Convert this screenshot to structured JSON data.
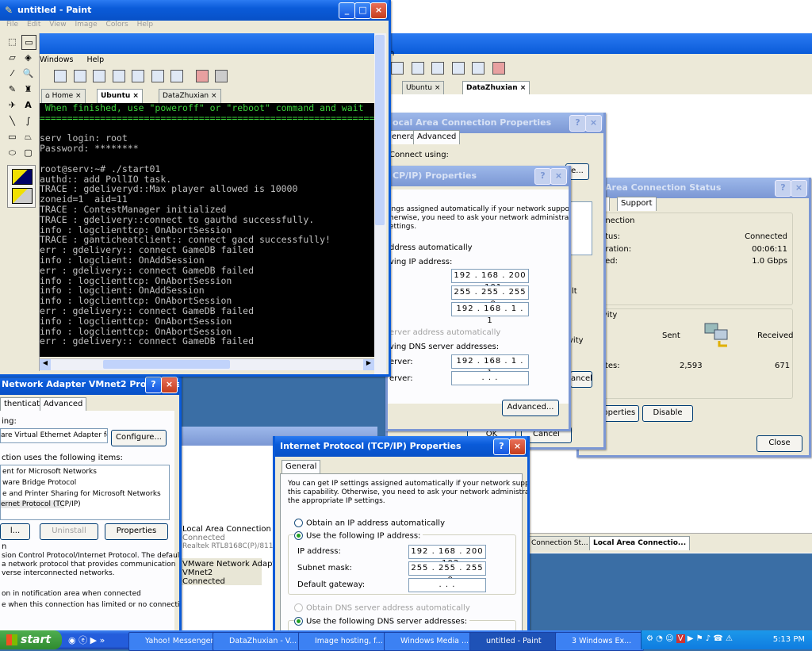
{
  "paint": {
    "title": "untitled - Paint",
    "menu": [
      "File",
      "Edit",
      "View",
      "Image",
      "Colors",
      "Help"
    ]
  },
  "vmware_back": {
    "tabs": [
      "Ubuntu",
      "DataZhuxian"
    ],
    "menu_letter": "n"
  },
  "vmware_front": {
    "menu": [
      "Windows",
      "Help"
    ],
    "tabs": [
      "Home",
      "Ubuntu",
      "DataZhuxian"
    ],
    "terminal_lines": [
      " When finished, use \"poweroff\" or \"reboot\" command and wait",
      "=============================================================",
      "",
      "serv login: root",
      "Password: ********",
      "",
      "root@serv:~# ./start01",
      "authd:: add PollIO task.",
      "TRACE : gdeliveryd::Max player allowed is 10000",
      "zoneid=1  aid=11",
      "TRACE : ContestManager initialized",
      "TRACE : gdelivery::connect to gauthd successfully.",
      "info : logclienttcp: OnAbortSession",
      "TRACE : ganticheatclient:: connect gacd successfully!",
      "err : gdelivery:: connect GameDB failed",
      "info : logclient: OnAddSession",
      "err : gdelivery:: connect GameDB failed",
      "info : logclienttcp: OnAbortSession",
      "info : logclient: OnAddSession",
      "info : logclienttcp: OnAbortSession",
      "err : gdelivery:: connect GameDB failed",
      "info : logclienttcp: OnAbortSession",
      "info : logclienttcp: OnAbortSession",
      "err : gdelivery:: connect GameDB failed"
    ]
  },
  "lac_props": {
    "title": "ocal Area Connection Properties",
    "tabs": [
      "eneral",
      "Advanced"
    ],
    "connect_using": "Connect using:",
    "configure": "e...",
    "ok": "OK",
    "cancel": "Cancel",
    "cancel_frag": "ancel",
    "frag_lt": "lt",
    "frag_vity": "vity"
  },
  "tcp_back": {
    "title": "CP/IP) Properties",
    "desc": "ings assigned automatically if your network supports\nherwise, you need to ask your network administrator for\nettings.",
    "obtain_auto": "ddress automatically",
    "use_following": "ving IP address:",
    "ip": "192 . 168 . 200 . 101",
    "mask": "255 . 255 . 255 . 0",
    "gateway": "192 . 168 . 1 . 1",
    "dns_auto": "erver address automatically",
    "dns_following": "ving DNS server addresses:",
    "pref_dns_label": "erver:",
    "pref_dns": "192 . 168 . 1 . 1",
    "alt_dns_label": "erver:",
    "alt_dns": ".       .       .",
    "advanced": "Advanced...",
    "ok": "OK",
    "cancel": "Cancel"
  },
  "status": {
    "title": "al Area Connection Status",
    "tabs": [
      "al",
      "Support"
    ],
    "connection": "nnection",
    "status_label": "atus:",
    "status_value": "Connected",
    "duration_label": "uration:",
    "duration_value": "00:06:11",
    "speed_label": "eed:",
    "speed_value": "1.0 Gbps",
    "activity": "ivity",
    "sent": "Sent",
    "received": "Received",
    "bytes_label": "ytes:",
    "sent_bytes": "2,593",
    "received_bytes": "671",
    "properties": "Properties",
    "disable": "Disable",
    "close": "Close"
  },
  "vmnet": {
    "title": "Network Adapter VMnet2 Properties",
    "tabs": [
      "thentication",
      "Advanced"
    ],
    "connect_using": "ing:",
    "adapter": "are Virtual Ethernet Adapter for V",
    "configure": "Configure...",
    "items_label": "ction uses the following items:",
    "items": [
      "ent for Microsoft Networks",
      "ware Bridge Protocol",
      "e and Printer Sharing for Microsoft Networks",
      "ernet Protocol (TCP/IP)"
    ],
    "install": "l...",
    "uninstall": "Uninstall",
    "properties": "Properties",
    "desc_title": "n",
    "desc": "sion Control Protocol/Internet Protocol. The default\na network protocol that provides communication\nverse interconnected networks.",
    "notify": "on in notification area when connected",
    "notify2": "e when this connection has limited or no connectivity"
  },
  "netconn": {
    "item1_name": "Local Area Connection",
    "item1_status": "Connected",
    "item1_device": "Realtek RTL8168C(P)/8111C(",
    "item2_name": "VMware Network Adapter",
    "item2_name2": "VMnet2",
    "item2_status": "Connected"
  },
  "tcp_front": {
    "title": "Internet Protocol (TCP/IP) Properties",
    "tab": "General",
    "desc": "You can get IP settings assigned automatically if your network supports\nthis capability. Otherwise, you need to ask your network administrator for\nthe appropriate IP settings.",
    "obtain_auto": "Obtain an IP address automatically",
    "use_following": "Use the following IP address:",
    "ip_label": "IP address:",
    "ip": "192 . 168 . 200 . 102",
    "mask_label": "Subnet mask:",
    "mask": "255 . 255 . 255 . 0",
    "gateway_label": "Default gateway:",
    "gateway": ".       .       .",
    "dns_auto": "Obtain DNS server address automatically",
    "dns_following": "Use the following DNS server addresses:"
  },
  "lower_tabs": [
    "Connection St...",
    "Local Area Connectio..."
  ],
  "taskbar": {
    "start": "start",
    "items": [
      "Yahoo! Messenger",
      "DataZhuxian - V...",
      "Image hosting, f...",
      "Windows Media ...",
      "untitled - Paint",
      "3 Windows Ex..."
    ],
    "clock": "5:13 PM"
  }
}
